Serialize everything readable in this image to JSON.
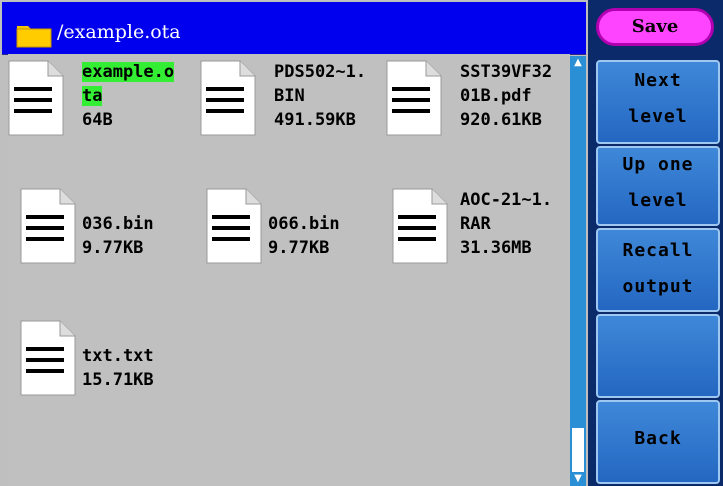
{
  "path_bar": {
    "path": "/example.ota",
    "icon": "folder-icon"
  },
  "files": [
    {
      "name_lines": [
        "example.o",
        "ta"
      ],
      "size": "64B",
      "selected": true,
      "icon": "document-icon"
    },
    {
      "name_lines": [
        "PDS502~1.",
        "BIN"
      ],
      "size": "491.59KB",
      "selected": false,
      "icon": "document-icon"
    },
    {
      "name_lines": [
        "SST39VF32",
        "01B.pdf"
      ],
      "size": "920.61KB",
      "selected": false,
      "icon": "document-icon"
    },
    {
      "name_lines": [
        "",
        "036.bin"
      ],
      "size": "9.77KB",
      "selected": false,
      "icon": "document-icon"
    },
    {
      "name_lines": [
        "",
        "066.bin"
      ],
      "size": "9.77KB",
      "selected": false,
      "icon": "document-icon"
    },
    {
      "name_lines": [
        "AOC-21~1.",
        "RAR"
      ],
      "size": "31.36MB",
      "selected": false,
      "icon": "document-icon"
    },
    {
      "name_lines": [
        "",
        "txt.txt"
      ],
      "size": "15.71KB",
      "selected": false,
      "icon": "document-icon"
    }
  ],
  "side_panel": {
    "save": "Save",
    "next_level": [
      "Next",
      "level"
    ],
    "up_one_level": [
      "Up one",
      "level"
    ],
    "recall_output": [
      "Recall",
      "output"
    ],
    "empty": "",
    "back": "Back"
  },
  "colors": {
    "selection": "#33ee33",
    "path_bar": "#0000ee",
    "save": "#ff44ff",
    "button": "#2f78cc"
  }
}
